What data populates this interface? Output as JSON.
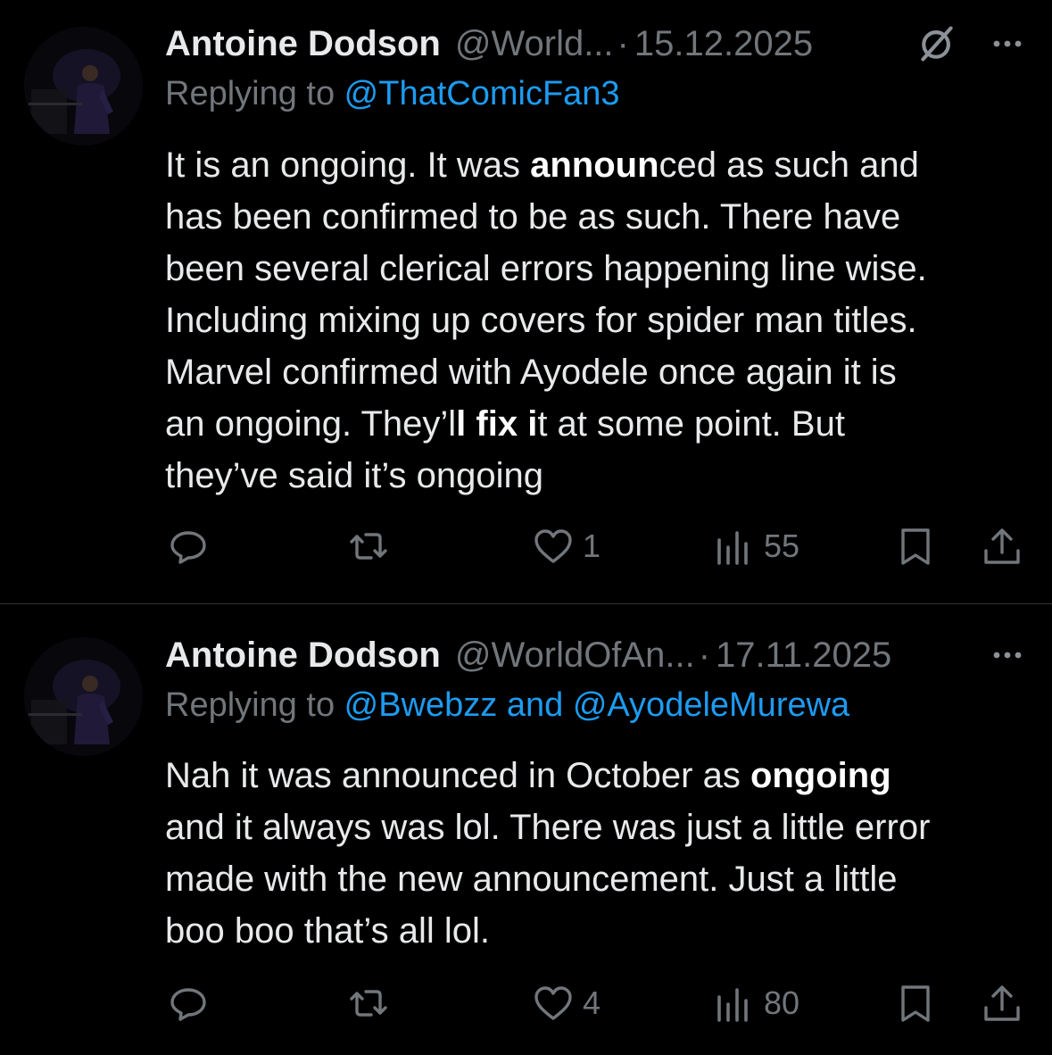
{
  "colors": {
    "background": "#000000",
    "text": "#e7e9ea",
    "muted": "#71767b",
    "link": "#1d9bf0",
    "divider": "#2f3336"
  },
  "tweets": [
    {
      "display_name": "Antoine Dodson",
      "handle": "@World...",
      "separator": "·",
      "date": "15.12.2025",
      "replying_prefix": "Replying to ",
      "mentions": "@ThatComicFan3",
      "body_segments": [
        {
          "text": "It is an ongoing. It was ",
          "bold": false
        },
        {
          "text": "announ",
          "bold": true
        },
        {
          "text": "ced as such and\nhas been confirmed to be as such. There have\nbeen several clerical errors happening line wise.\nIncluding mixing up covers for spider man titles.\nMarvel confirmed with Ayodele once again it is\nan ongoing. They’l",
          "bold": false
        },
        {
          "text": "l fix i",
          "bold": true
        },
        {
          "text": "t at some point. But\nthey’ve said it’s ongoing",
          "bold": false
        }
      ],
      "counts": {
        "replies": "",
        "retweets": "",
        "likes": "1",
        "views": "55"
      },
      "icons": [
        "avatar",
        "grok-icon",
        "more-icon",
        "reply-icon",
        "retweet-icon",
        "heart-icon",
        "views-icon",
        "bookmark-icon",
        "share-icon"
      ]
    },
    {
      "display_name": "Antoine Dodson",
      "handle": "@WorldOfAn...",
      "separator": "·",
      "date": "17.11.2025",
      "replying_prefix": "Replying to ",
      "mentions": "@Bwebzz and @AyodeleMurewa",
      "body_segments": [
        {
          "text": "Nah it was announced in October as ",
          "bold": false
        },
        {
          "text": "ongoing",
          "bold": true
        },
        {
          "text": "\nand it always was lol. There was just a little error\nmade with the new announcement. Just a little\nboo boo that’s all lol.",
          "bold": false
        }
      ],
      "counts": {
        "replies": "",
        "retweets": "",
        "likes": "4",
        "views": "80"
      },
      "icons": [
        "avatar",
        "more-icon",
        "reply-icon",
        "retweet-icon",
        "heart-icon",
        "views-icon",
        "bookmark-icon",
        "share-icon"
      ]
    }
  ]
}
